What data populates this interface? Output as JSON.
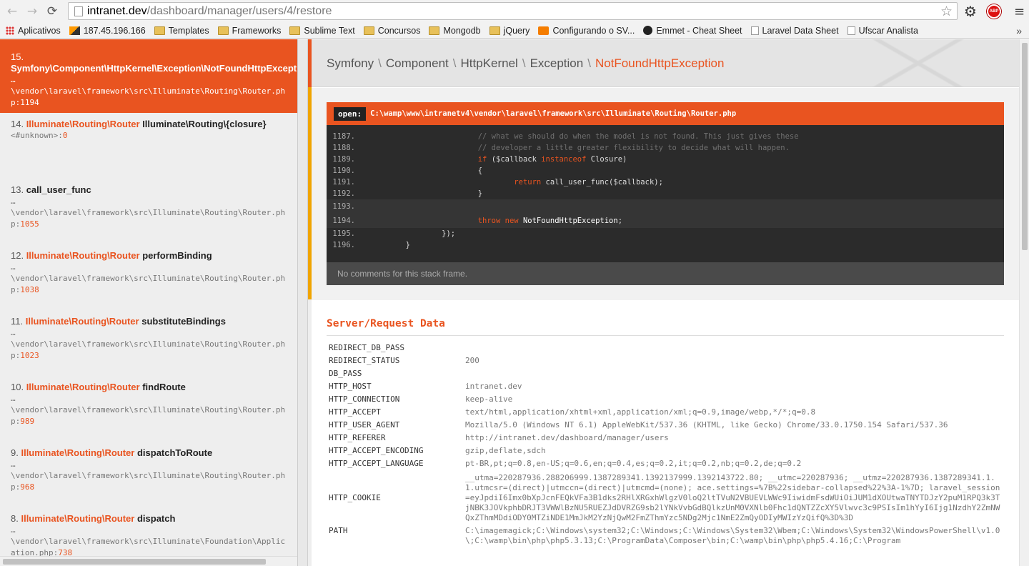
{
  "browser": {
    "url_host": "intranet.dev",
    "url_path": "/dashboard/manager/users/4/restore",
    "back_icon": "back-arrow-icon",
    "forward_icon": "forward-arrow-icon",
    "reload_icon": "reload-icon",
    "back_glyph": "←",
    "forward_glyph": "→",
    "reload_glyph": "⟳",
    "star_glyph": "☆",
    "gear_glyph": "⚙",
    "menu_glyph": "≡",
    "adblock_glyph": "ABP",
    "overflow_glyph": "»"
  },
  "bookmarks": [
    {
      "label": "Aplicativos",
      "icon": "apps"
    },
    {
      "label": "187.45.196.166",
      "icon": "pma"
    },
    {
      "label": "Templates",
      "icon": "folder"
    },
    {
      "label": "Frameworks",
      "icon": "folder"
    },
    {
      "label": "Sublime Text",
      "icon": "folder"
    },
    {
      "label": "Concursos",
      "icon": "folder"
    },
    {
      "label": "Mongodb",
      "icon": "folder"
    },
    {
      "label": "jQuery",
      "icon": "folder"
    },
    {
      "label": "Configurando o SV...",
      "icon": "blog"
    },
    {
      "label": "Emmet - Cheat Sheet",
      "icon": "emmet"
    },
    {
      "label": "Laravel Data Sheet",
      "icon": "page"
    },
    {
      "label": "Ufscar Analista",
      "icon": "page"
    }
  ],
  "frames": [
    {
      "num": "15.",
      "cls": "Symfony\\Component\\HttpKernel\\Exception\\NotFoundHttpException",
      "fn": "",
      "dots": "…",
      "path": "\\vendor\\laravel\\framework\\src\\Illuminate\\Routing\\Router.php",
      "line": "1194"
    },
    {
      "num": "14.",
      "cls": "Illuminate\\Routing\\Router",
      "fn": "Illuminate\\Routing\\{closure}",
      "path": "<#unknown>",
      "line": "0"
    },
    {
      "num": "13.",
      "cls": "",
      "fn": "call_user_func",
      "dots": "…",
      "path": "\\vendor\\laravel\\framework\\src\\Illuminate\\Routing\\Router.php",
      "line": "1055"
    },
    {
      "num": "12.",
      "cls": "Illuminate\\Routing\\Router",
      "fn": "performBinding",
      "dots": "…",
      "path": "\\vendor\\laravel\\framework\\src\\Illuminate\\Routing\\Router.php",
      "line": "1038"
    },
    {
      "num": "11.",
      "cls": "Illuminate\\Routing\\Router",
      "fn": "substituteBindings",
      "dots": "…",
      "path": "\\vendor\\laravel\\framework\\src\\Illuminate\\Routing\\Router.php",
      "line": "1023"
    },
    {
      "num": "10.",
      "cls": "Illuminate\\Routing\\Router",
      "fn": "findRoute",
      "dots": "…",
      "path": "\\vendor\\laravel\\framework\\src\\Illuminate\\Routing\\Router.php",
      "line": "989"
    },
    {
      "num": "9.",
      "cls": "Illuminate\\Routing\\Router",
      "fn": "dispatchToRoute",
      "dots": "…",
      "path": "\\vendor\\laravel\\framework\\src\\Illuminate\\Routing\\Router.php",
      "line": "968"
    },
    {
      "num": "8.",
      "cls": "Illuminate\\Routing\\Router",
      "fn": "dispatch",
      "dots": "…",
      "path": "\\vendor\\laravel\\framework\\src\\Illuminate\\Foundation\\Application.php",
      "line": "738"
    }
  ],
  "exception": {
    "parts": [
      "Symfony",
      "Component",
      "HttpKernel",
      "Exception"
    ],
    "name": "NotFoundHttpException"
  },
  "code": {
    "open_label": "open:",
    "file": "C:\\wamp\\www\\intranetv4\\vendor\\laravel\\framework\\src\\Illuminate\\Routing\\Router.php",
    "footer": "No comments for this stack frame.",
    "lines": [
      {
        "n": "1187.",
        "tokens": [
          [
            "cm",
            "                        // what we should do when the model is not found. This just gives these"
          ]
        ]
      },
      {
        "n": "1188.",
        "tokens": [
          [
            "cm",
            "                        // developer a little greater flexibility to decide what will happen."
          ]
        ]
      },
      {
        "n": "1189.",
        "tokens": [
          [
            "",
            "                        "
          ],
          [
            "kw",
            "if"
          ],
          [
            "",
            " ($callback "
          ],
          [
            "kw",
            "instanceof"
          ],
          [
            "",
            " Closure)"
          ]
        ]
      },
      {
        "n": "1190.",
        "tokens": [
          [
            "",
            "                        {"
          ]
        ]
      },
      {
        "n": "1191.",
        "tokens": [
          [
            "",
            "                                "
          ],
          [
            "kw",
            "return"
          ],
          [
            "",
            " call_user_func($callback);"
          ]
        ]
      },
      {
        "n": "1192.",
        "tokens": [
          [
            "",
            "                        }"
          ]
        ]
      },
      {
        "n": "1193.",
        "tokens": [
          [
            "",
            ""
          ]
        ],
        "hl": true,
        "gap": true
      },
      {
        "n": "1194.",
        "tokens": [
          [
            "",
            "                        "
          ],
          [
            "kw",
            "throw"
          ],
          [
            "",
            " "
          ],
          [
            "kw",
            "new"
          ],
          [
            "nf",
            " NotFoundHttpException"
          ],
          [
            "",
            ";"
          ]
        ],
        "hl": true,
        "gap": true
      },
      {
        "n": "1195.",
        "tokens": [
          [
            "",
            "                });"
          ]
        ]
      },
      {
        "n": "1196.",
        "tokens": [
          [
            "",
            "        }"
          ]
        ]
      }
    ]
  },
  "server": {
    "title": "Server/Request Data",
    "rows": [
      {
        "k": "REDIRECT_DB_PASS",
        "v": ""
      },
      {
        "k": "REDIRECT_STATUS",
        "v": "200"
      },
      {
        "k": "DB_PASS",
        "v": ""
      },
      {
        "k": "HTTP_HOST",
        "v": "intranet.dev"
      },
      {
        "k": "HTTP_CONNECTION",
        "v": "keep-alive"
      },
      {
        "k": "HTTP_ACCEPT",
        "v": "text/html,application/xhtml+xml,application/xml;q=0.9,image/webp,*/*;q=0.8"
      },
      {
        "k": "HTTP_USER_AGENT",
        "v": "Mozilla/5.0 (Windows NT 6.1) AppleWebKit/537.36 (KHTML, like Gecko) Chrome/33.0.1750.154 Safari/537.36"
      },
      {
        "k": "HTTP_REFERER",
        "v": "http://intranet.dev/dashboard/manager/users"
      },
      {
        "k": "HTTP_ACCEPT_ENCODING",
        "v": "gzip,deflate,sdch"
      },
      {
        "k": "HTTP_ACCEPT_LANGUAGE",
        "v": "pt-BR,pt;q=0.8,en-US;q=0.6,en;q=0.4,es;q=0.2,it;q=0.2,nb;q=0.2,de;q=0.2"
      },
      {
        "k": "HTTP_COOKIE",
        "v": "__utma=220287936.288206999.1387289341.1392137999.1392143722.80; __utmc=220287936; __utmz=220287936.1387289341.1.1.utmcsr=(direct)|utmccn=(direct)|utmcmd=(none); ace.settings=%7B%22sidebar-collapsed%22%3A-1%7D; laravel_session=eyJpdiI6Imx0bXpJcnFEQkVFa3B1dks2RHlXRGxhWlgzV0loQ2ltTVuN2VBUEVLWWc9IiwidmFsdWUiOiJUM1dXOUtwaTNYTDJzY2puM1RPQ3k3TjNBK3JOVkphbDRJT3VWWlBzNU5RUEZJdDVRZG9sb2lYNkVvbGdBQlkzUnM0VXNlb0Fhc1dQNTZZcXY5Vlwvc3c9PSIsIm1hYyI6Ijg1NzdhY2ZmNWQxZThmMDdiODY0MTZiNDE1MmJkM2YzNjQwM2FmZThmYzc5NDg2Mjc1NmE2ZmQyODIyMWIzYzQifQ%3D%3D"
      },
      {
        "k": "PATH",
        "v": "C:\\imagemagick;C:\\Windows\\system32;C:\\Windows;C:\\Windows\\System32\\Wbem;C:\\Windows\\System32\\WindowsPowerShell\\v1.0\\;C:\\wamp\\bin\\php\\php5.3.13;C:\\ProgramData\\Composer\\bin;C:\\wamp\\bin\\php\\php5.4.16;C:\\Program"
      }
    ]
  }
}
